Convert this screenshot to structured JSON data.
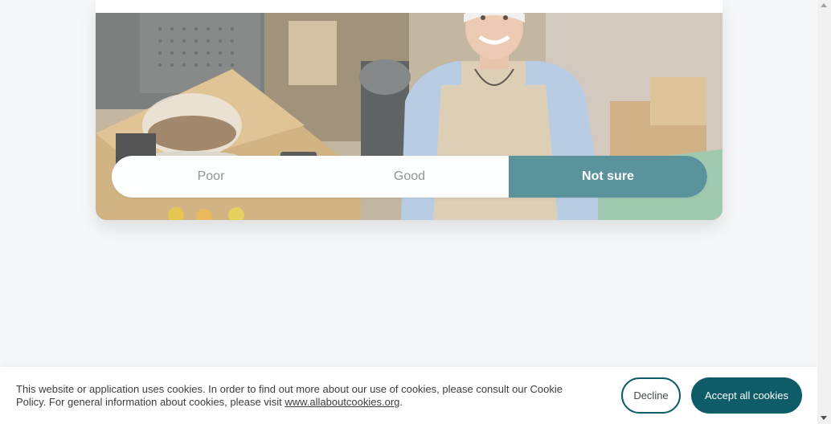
{
  "rating": {
    "options": [
      {
        "label": "Poor",
        "selected": false
      },
      {
        "label": "Good",
        "selected": false
      },
      {
        "label": "Not sure",
        "selected": true
      }
    ],
    "accent_color": "#5b939c"
  },
  "photo": {
    "description_icon": "shopkeeper-photo"
  },
  "cookie_banner": {
    "text_before_link": "This website or application uses cookies. In order to find out more about our use of cookies, please consult our Cookie Policy. For general information about cookies, please visit ",
    "link_text": "www.allaboutcookies.org",
    "text_after_link": ".",
    "decline_label": "Decline",
    "accept_label": "Accept all cookies",
    "brand_color": "#0e5c68"
  }
}
